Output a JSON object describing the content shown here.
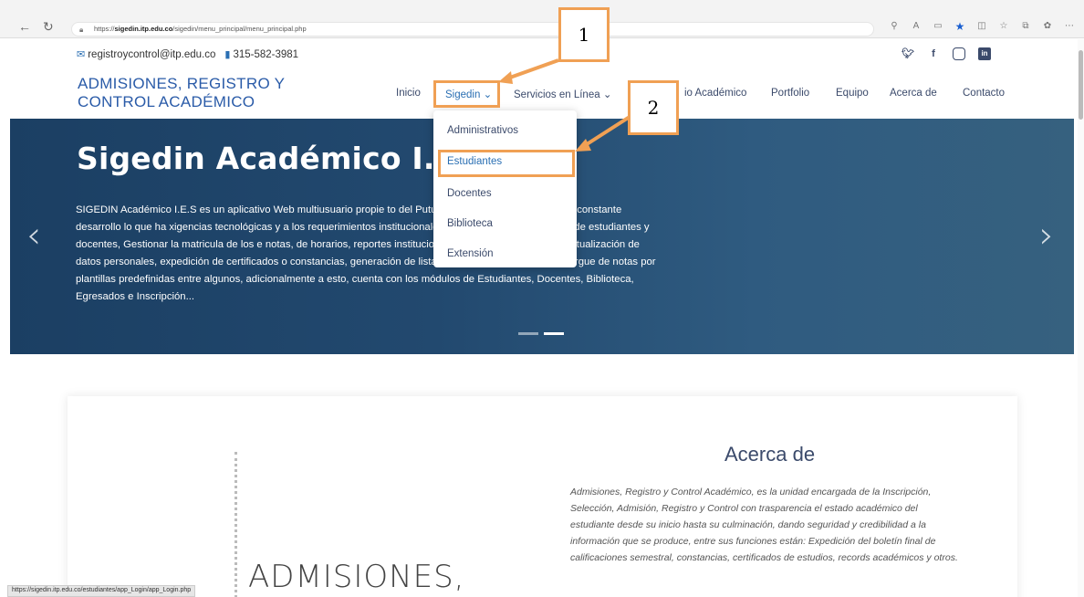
{
  "browser": {
    "url_prefix": "https://",
    "url_host": "sigedin.itp.edu.co",
    "url_path": "/sigedin/menu_principal/menu_principal.php",
    "icons": [
      "zoom-icon",
      "read-aloud-icon",
      "reader-icon",
      "favorite-star-icon",
      "split-icon",
      "favorites-icon",
      "collections-icon",
      "extensions-icon",
      "more-icon"
    ]
  },
  "contact": {
    "email": "registroycontrol@itp.edu.co",
    "phone": "315-582-3981"
  },
  "brand": {
    "line1": "ADMISIONES, REGISTRO Y",
    "line2": "CONTROL ACADÉMICO"
  },
  "menu": {
    "inicio": "Inicio",
    "sigedin": "Sigedin",
    "servicios": "Servicios en Línea",
    "calendario": "io Académico",
    "portfolio": "Portfolio",
    "equipo": "Equipo",
    "acerca": "Acerca de",
    "contacto": "Contacto"
  },
  "dropdown": [
    "Administrativos",
    "Estudiantes",
    "Docentes",
    "Biblioteca",
    "Extensión"
  ],
  "hero": {
    "title": "Sigedin Académico I.",
    "title_tail": "",
    "text": "SIGEDIN Académico I.E.S es un aplicativo Web multiusuario propie                              to del Putumayo, el cual se encuentra en constante desarrollo lo que ha                            xigencias tecnológicas y a los requerimientos institucionales. Permite entre                            a inscripción de estudiantes y docentes, Gestionar la matricula de los                            e notas, de horarios, reportes institucionales y nacionales (SNIES), actualización de datos personales, expedición de certificados o constancias, generación de listados, Gestión de parciales y cargue de notas por plantillas predefinidas entre algunos, adicionalmente a esto, cuenta con los módulos de Estudiantes, Docentes, Biblioteca, Egresados e Inscripción..."
  },
  "about": {
    "title": "Acerca de",
    "big": "ADMISIONES,",
    "text": "Admisiones, Registro y Control Académico, es la unidad encargada de la Inscripción, Selección, Admisión, Registro y Control con trasparencia el estado académico del estudiante desde su inicio hasta su culminación, dando seguridad y credibilidad a la información que se produce, entre sus funciones están: Expedición del boletín final de calificaciones semestral, constancias, certificados de estudios, records académicos y otros."
  },
  "status_url": "https://sigedin.itp.edu.co/estudiantes/app_Login/app_Login.php",
  "annotations": [
    "1",
    "2"
  ],
  "colors": {
    "accent": "#2a6fb3",
    "annotation": "#f0a054",
    "hero": "#1b3f63"
  }
}
